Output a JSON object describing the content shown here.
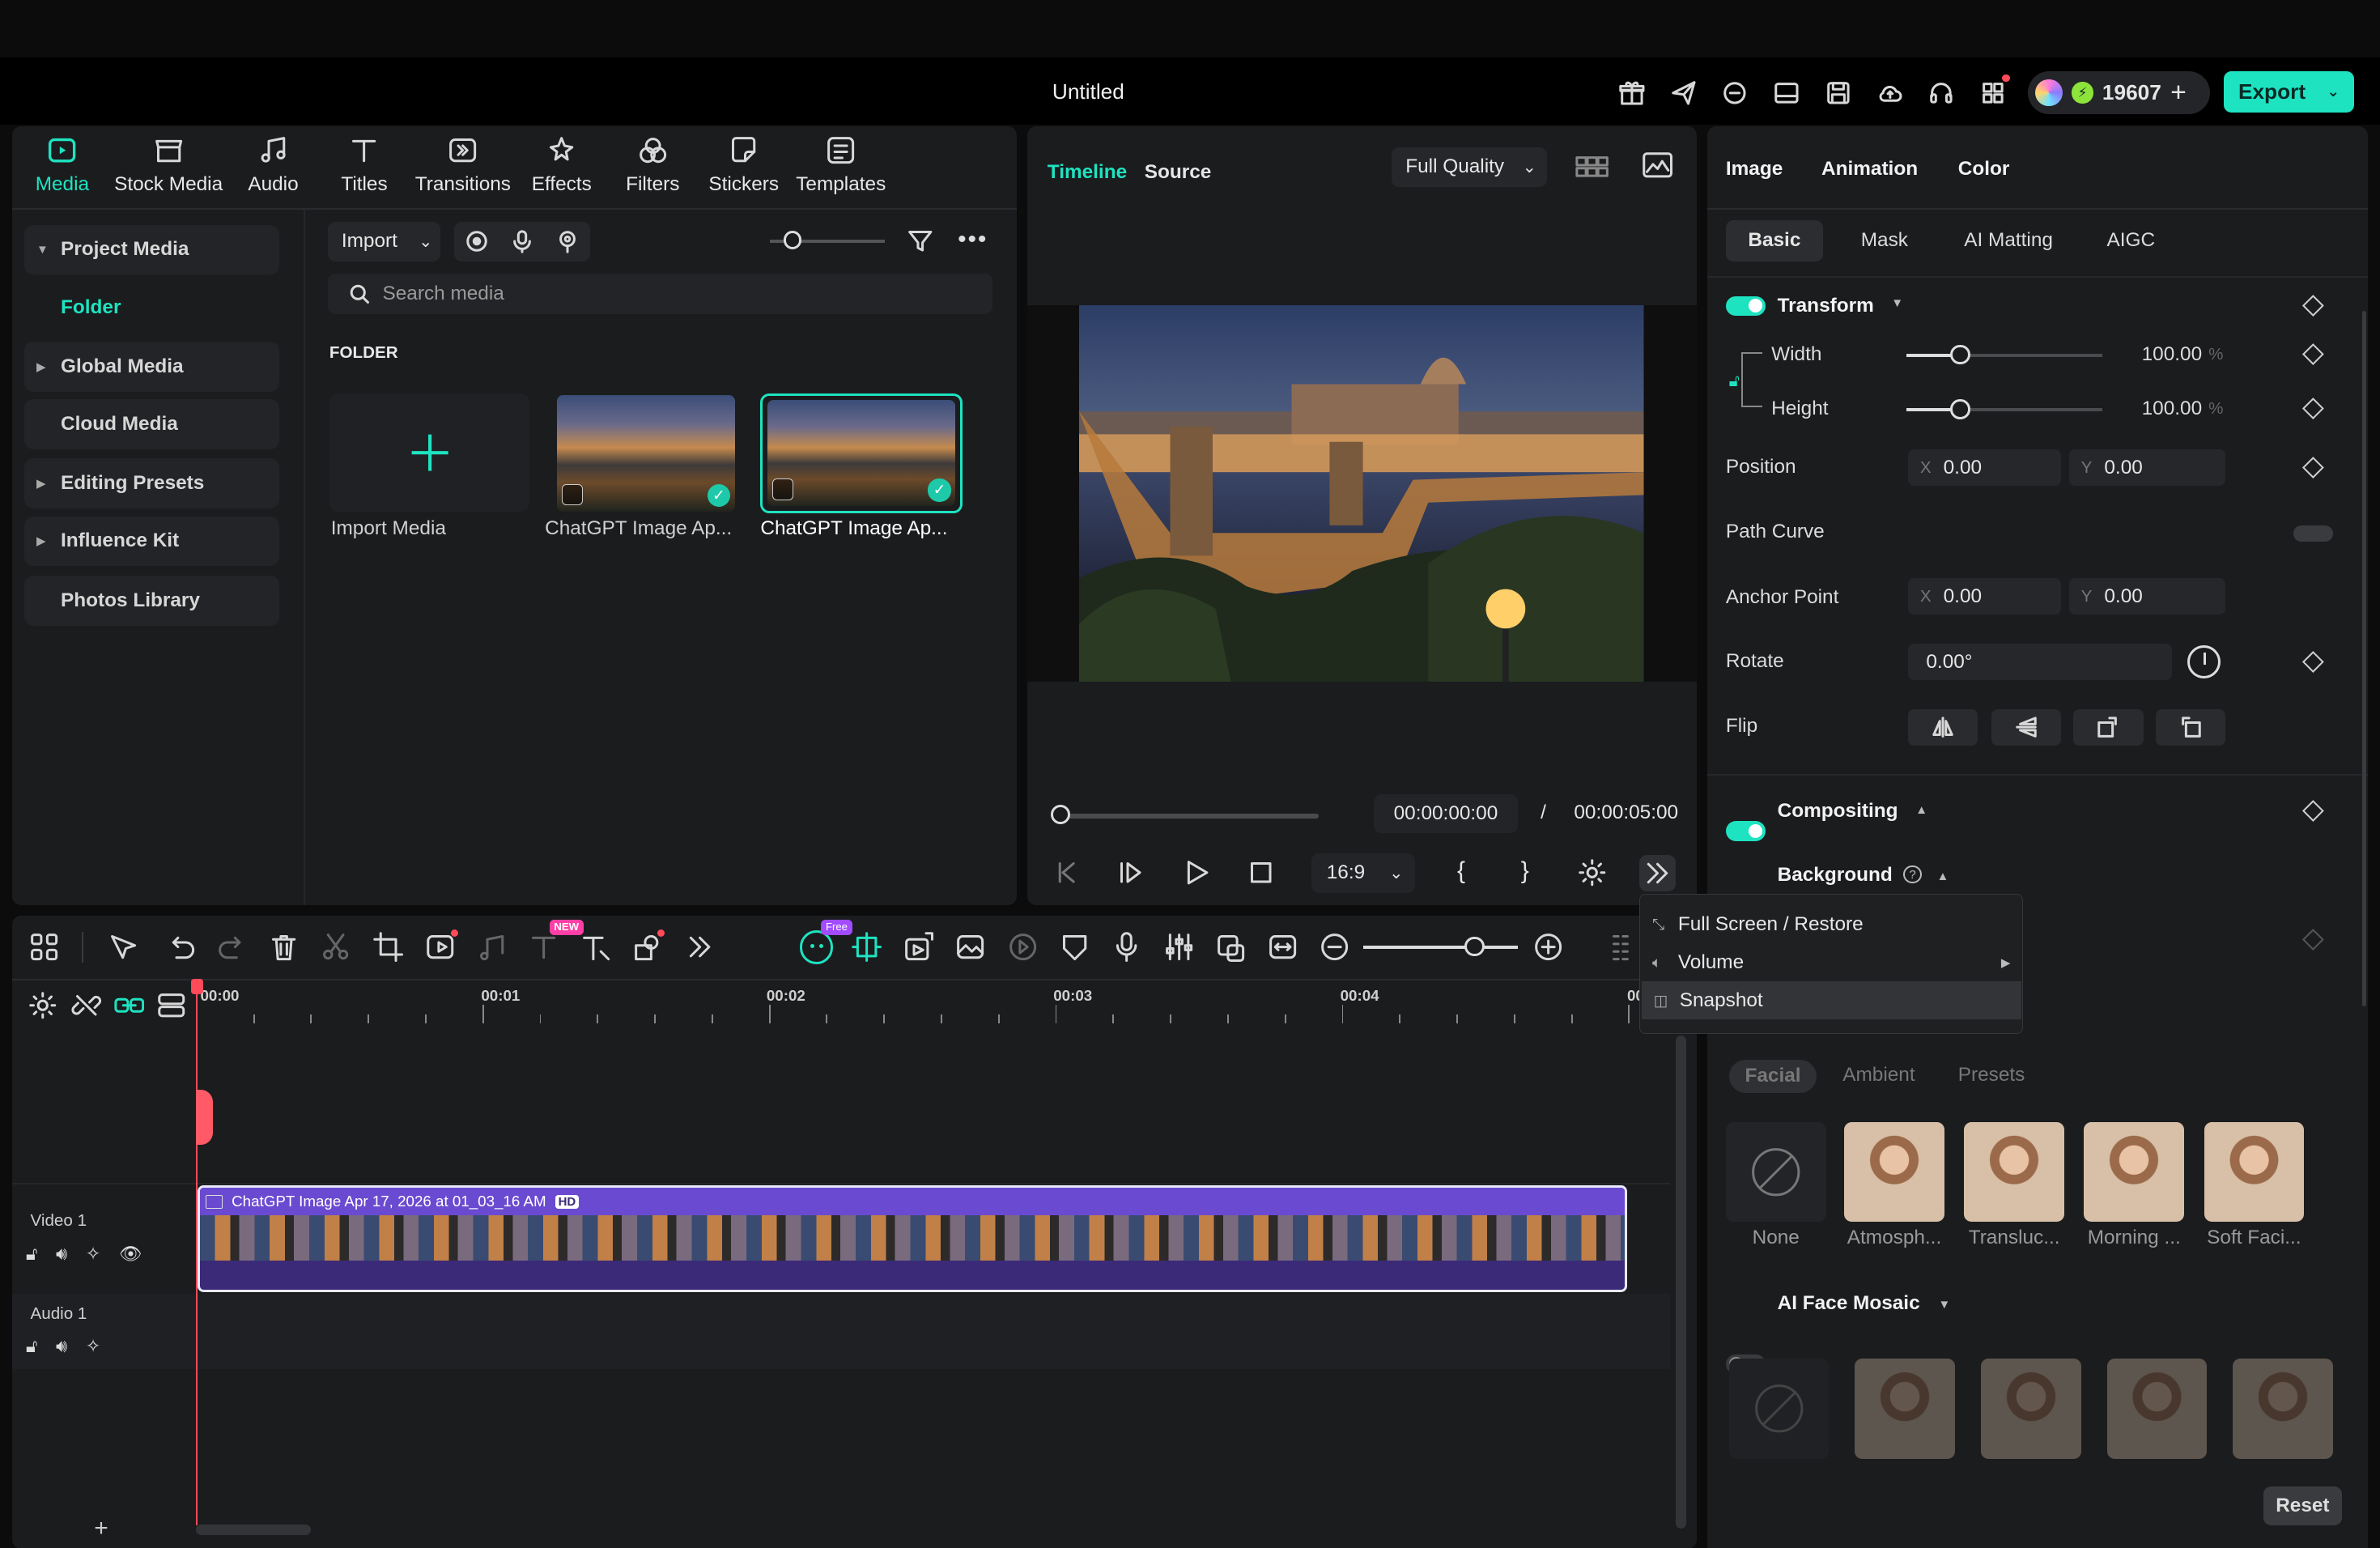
{
  "app": {
    "title": "Untitled",
    "credits": "19607",
    "export_label": "Export"
  },
  "media_tabs": [
    {
      "label": "Media",
      "icon": "media-icon",
      "active": true
    },
    {
      "label": "Stock Media",
      "icon": "stock-media-icon"
    },
    {
      "label": "Audio",
      "icon": "audio-icon"
    },
    {
      "label": "Titles",
      "icon": "titles-icon"
    },
    {
      "label": "Transitions",
      "icon": "transitions-icon"
    },
    {
      "label": "Effects",
      "icon": "effects-icon"
    },
    {
      "label": "Filters",
      "icon": "filters-icon"
    },
    {
      "label": "Stickers",
      "icon": "stickers-icon"
    },
    {
      "label": "Templates",
      "icon": "templates-icon"
    }
  ],
  "sidebar": {
    "project_media": "Project Media",
    "folder": "Folder",
    "global_media": "Global Media",
    "cloud_media": "Cloud Media",
    "editing_presets": "Editing Presets",
    "influence_kit": "Influence Kit",
    "photos_library": "Photos Library"
  },
  "media": {
    "import_label": "Import",
    "search_placeholder": "Search media",
    "folder_heading": "FOLDER",
    "import_media_label": "Import Media",
    "items": [
      {
        "caption": "ChatGPT Image Ap..."
      },
      {
        "caption": "ChatGPT Image Ap...",
        "selected": true
      }
    ]
  },
  "preview": {
    "tab_timeline": "Timeline",
    "tab_source": "Source",
    "quality": "Full Quality",
    "current_time": "00:00:00:00",
    "separator": "/",
    "total_time": "00:00:05:00",
    "aspect": "16:9",
    "mark_in": "{",
    "mark_out": "}"
  },
  "popup_menu": {
    "items": [
      {
        "label": "Full Screen / Restore",
        "icon": "fullscreen-icon"
      },
      {
        "label": "Volume",
        "icon": "volume-icon",
        "submenu": true
      },
      {
        "label": "Snapshot",
        "icon": "camera-icon",
        "highlighted": true
      }
    ]
  },
  "inspector": {
    "tabs": [
      "Image",
      "Animation",
      "Color"
    ],
    "subtabs": [
      "Basic",
      "Mask",
      "AI Matting",
      "AIGC"
    ],
    "transform": {
      "label": "Transform",
      "width_label": "Width",
      "width_value": "100.00",
      "width_unit": "%",
      "height_label": "Height",
      "height_value": "100.00",
      "height_unit": "%",
      "position_label": "Position",
      "pos_x_key": "X",
      "pos_x": "0.00",
      "pos_y_key": "Y",
      "pos_y": "0.00",
      "path_curve_label": "Path Curve",
      "anchor_label": "Anchor Point",
      "anchor_x_key": "X",
      "anchor_x": "0.00",
      "anchor_y_key": "Y",
      "anchor_y": "0.00",
      "rotate_label": "Rotate",
      "rotate_value": "0.00°",
      "flip_label": "Flip"
    },
    "compositing_label": "Compositing",
    "background_label": "Background",
    "face_tabs": [
      "Facial",
      "Ambient",
      "Presets"
    ],
    "face_presets": [
      {
        "label": "None"
      },
      {
        "label": "Atmosph..."
      },
      {
        "label": "Transluc..."
      },
      {
        "label": "Morning ..."
      },
      {
        "label": "Soft Faci..."
      }
    ],
    "ai_face_mosaic_label": "AI Face Mosaic",
    "reset_label": "Reset"
  },
  "timeline": {
    "ruler": [
      "00:00",
      "00:01",
      "00:02",
      "00:03",
      "00:04",
      "00"
    ],
    "free_badge": "Free",
    "new_badge": "NEW",
    "tracks": {
      "video_label": "Video 1",
      "audio_label": "Audio 1",
      "clip_title": "ChatGPT Image Apr 17, 2026 at 01_03_16 AM",
      "clip_badge": "HD"
    }
  }
}
